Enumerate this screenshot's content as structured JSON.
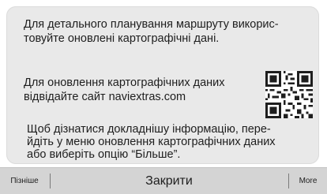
{
  "dialog": {
    "paragraph_1": "Для детального планування маршруту викорис-\nтовуйте оновлені картографічні дані.",
    "paragraph_2": "Для оновлення картографічних даних відвідайте сайт naviextras.com",
    "paragraph_3": "Щоб дізнатися докладнішу інформацію, пере-\nйдіть у меню оновлення картографічних даних\nабо виберіть опцію “Більше”."
  },
  "qr_code": {
    "icon": "qr-code-icon"
  },
  "bottom_bar": {
    "later_label": "Пізніше",
    "close_label": "Закрити",
    "more_label": "More"
  },
  "colors": {
    "panel_bg": "#e9e9e9",
    "bar_bg": "#d4d4d4",
    "text": "#1e1e1e"
  }
}
